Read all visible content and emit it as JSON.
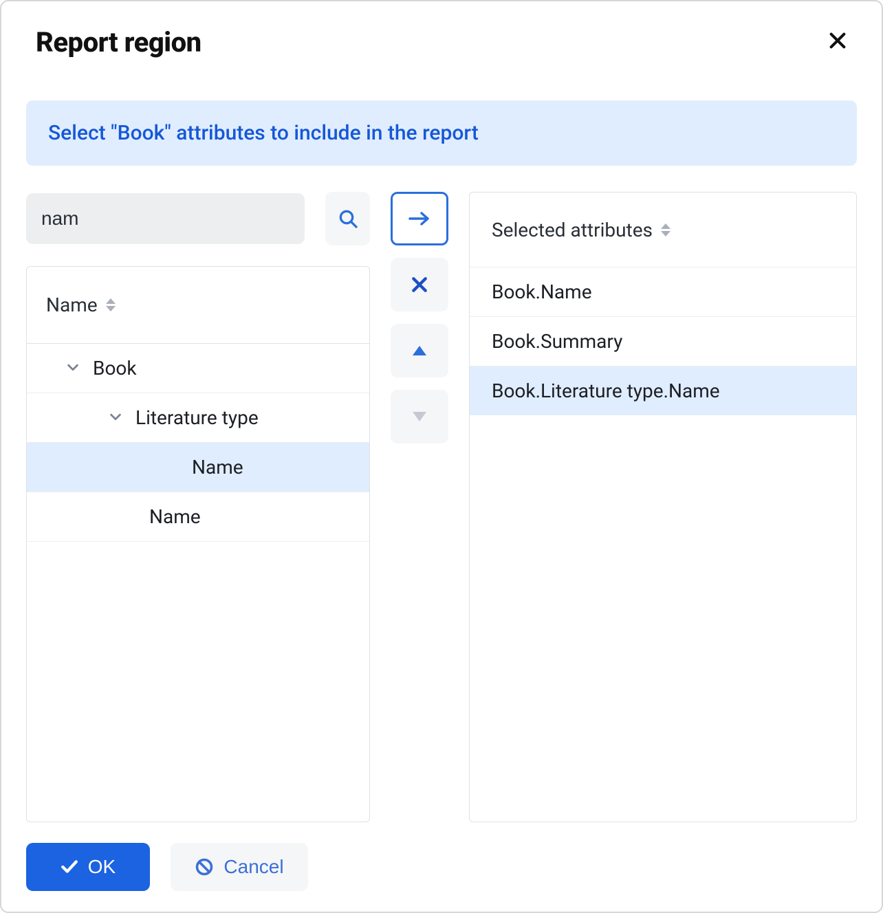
{
  "dialog": {
    "title": "Report region",
    "banner": "Select \"Book\" attributes to include in the report"
  },
  "search": {
    "value": "nam"
  },
  "tree": {
    "header": "Name",
    "rows": [
      {
        "label": "Book",
        "indent": 1,
        "expandable": true,
        "selected": false
      },
      {
        "label": "Literature type",
        "indent": 2,
        "expandable": true,
        "selected": false
      },
      {
        "label": "Name",
        "indent": 3,
        "expandable": false,
        "selected": true
      },
      {
        "label": "Name",
        "indent": 1,
        "expandable": false,
        "selected": false
      }
    ]
  },
  "selected_panel": {
    "header": "Selected attributes",
    "items": [
      {
        "label": "Book.Name",
        "selected": false
      },
      {
        "label": "Book.Summary",
        "selected": false
      },
      {
        "label": "Book.Literature type.Name",
        "selected": true
      }
    ]
  },
  "buttons": {
    "ok": "OK",
    "cancel": "Cancel"
  }
}
